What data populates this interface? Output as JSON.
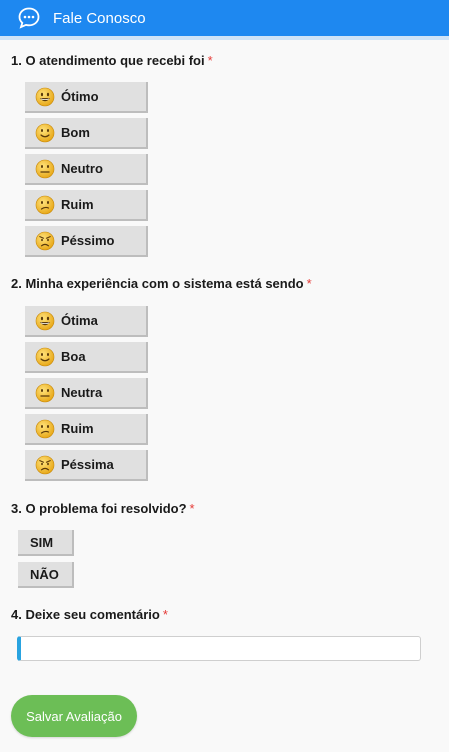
{
  "header": {
    "title": "Fale Conosco",
    "icon": "chat-bubble-icon",
    "color": "#1e88f0"
  },
  "questions": [
    {
      "label": "1. O atendimento que recebi foi",
      "required_mark": "*",
      "options": [
        {
          "label": "Ótimo",
          "icon": "grinning-face-icon"
        },
        {
          "label": "Bom",
          "icon": "smiling-face-icon"
        },
        {
          "label": "Neutro",
          "icon": "neutral-face-icon"
        },
        {
          "label": "Ruim",
          "icon": "confused-face-icon"
        },
        {
          "label": "Péssimo",
          "icon": "angry-face-icon"
        }
      ]
    },
    {
      "label": "2. Minha experiência com o sistema está sendo",
      "required_mark": "*",
      "options": [
        {
          "label": "Ótima",
          "icon": "grinning-face-icon"
        },
        {
          "label": "Boa",
          "icon": "smiling-face-icon"
        },
        {
          "label": "Neutra",
          "icon": "neutral-face-icon"
        },
        {
          "label": "Ruim",
          "icon": "confused-face-icon"
        },
        {
          "label": "Péssima",
          "icon": "angry-face-icon"
        }
      ]
    },
    {
      "label": "3. O problema foi resolvido?",
      "required_mark": "*",
      "options": [
        {
          "label": "SIM"
        },
        {
          "label": "NÃO"
        }
      ]
    },
    {
      "label": "4. Deixe seu comentário",
      "required_mark": "*",
      "value": "",
      "placeholder": ""
    }
  ],
  "save_button": {
    "label": "Salvar Avaliação",
    "color": "#6cbe56"
  },
  "colors": {
    "required": "#e53935",
    "option_bg": "#e0e0e0",
    "emoji_fill": "#f5c542"
  }
}
